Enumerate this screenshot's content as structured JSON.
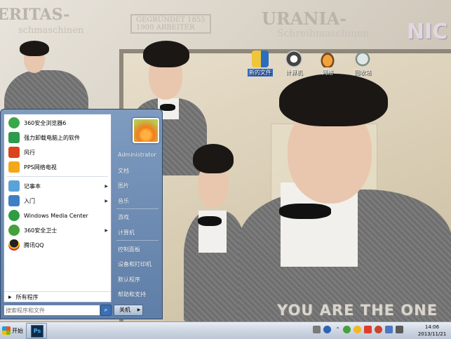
{
  "wallpaper": {
    "top_left_text": "ERITAS-",
    "top_left_sub": "schmaschinen",
    "stamp_text": "GEGRÜNDET 1855",
    "stamp_text_2": "1900 ARBEITER",
    "urania_title": "URANIA-",
    "urania_sub": "Schreibmaschinen",
    "corner_text": "NIC",
    "slogan": "YOU ARE THE ONE"
  },
  "desktop_icons": [
    {
      "label": "新的文件",
      "icon": "folder-icon",
      "selected": true
    },
    {
      "label": "计算机",
      "icon": "computer-icon",
      "selected": false
    },
    {
      "label": "网络",
      "icon": "network-icon",
      "selected": false
    },
    {
      "label": "回收站",
      "icon": "recycle-bin-icon",
      "selected": false
    }
  ],
  "start_menu": {
    "programs": [
      {
        "label": "360安全浏览器6",
        "icon": "360-browser-icon",
        "color": "#3aa84a",
        "has_submenu": false
      },
      {
        "label": "强力卸载电脑上的软件",
        "icon": "uninstall-icon",
        "color": "#2d9a4c",
        "has_submenu": false
      },
      {
        "label": "风行",
        "icon": "funshion-icon",
        "color": "#d9431e",
        "has_submenu": false
      },
      {
        "label": "PPS网络电视",
        "icon": "pps-icon",
        "color": "#f3a71a",
        "has_submenu": false
      },
      {
        "label": "记事本",
        "icon": "notepad-icon",
        "color": "#5aa3d8",
        "has_submenu": true
      },
      {
        "label": "入门",
        "icon": "getting-started-icon",
        "color": "#3e7fc6",
        "has_submenu": true
      },
      {
        "label": "Windows Media Center",
        "icon": "windows-media-center-icon",
        "color": "#2f9c42",
        "has_submenu": false
      },
      {
        "label": "360安全卫士",
        "icon": "360-safe-icon",
        "color": "#45a13a",
        "has_submenu": true
      },
      {
        "label": "腾讯QQ",
        "icon": "qq-icon",
        "color": "#222222",
        "has_submenu": false
      }
    ],
    "all_programs": "所有程序",
    "search_placeholder": "搜索程序和文件",
    "user_name": "Administrator",
    "right_links": [
      "文档",
      "图片",
      "音乐",
      "游戏",
      "计算机",
      "控制面板",
      "设备和打印机",
      "默认程序",
      "帮助和支持"
    ],
    "shutdown_label": "关机"
  },
  "taskbar": {
    "start_label": "开始",
    "task_ps_label": "Ps",
    "tray_icons": [
      "action-center-icon",
      "help-icon",
      "expand-tray-icon",
      "360-tray-icon",
      "network-tray-icon",
      "qq-tray-icon",
      "fan-tray-icon",
      "display-tray-icon",
      "volume-icon"
    ],
    "time": "14:06",
    "date": "2013/11/21"
  }
}
